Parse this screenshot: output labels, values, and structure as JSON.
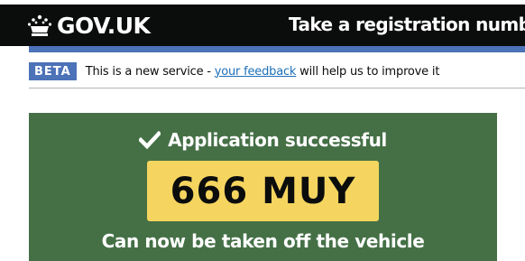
{
  "header": {
    "logo_text": "GOV.UK",
    "logo_icon": "crown-icon",
    "service_name": "Take a registration number off"
  },
  "phase_banner": {
    "tag": "BETA",
    "text_before": "This is a new service - ",
    "link_text": "your feedback",
    "text_after": " will help us to improve it"
  },
  "confirmation": {
    "icon": "tick-icon",
    "title": "Application successful",
    "registration": "666 MUY",
    "message": "Can now be taken off the vehicle"
  },
  "colors": {
    "header_bg": "#0b0c0c",
    "accent_blue": "#4c72b8",
    "panel_green": "#457046",
    "plate_yellow": "#f5d55f",
    "link": "#1d70b8"
  }
}
